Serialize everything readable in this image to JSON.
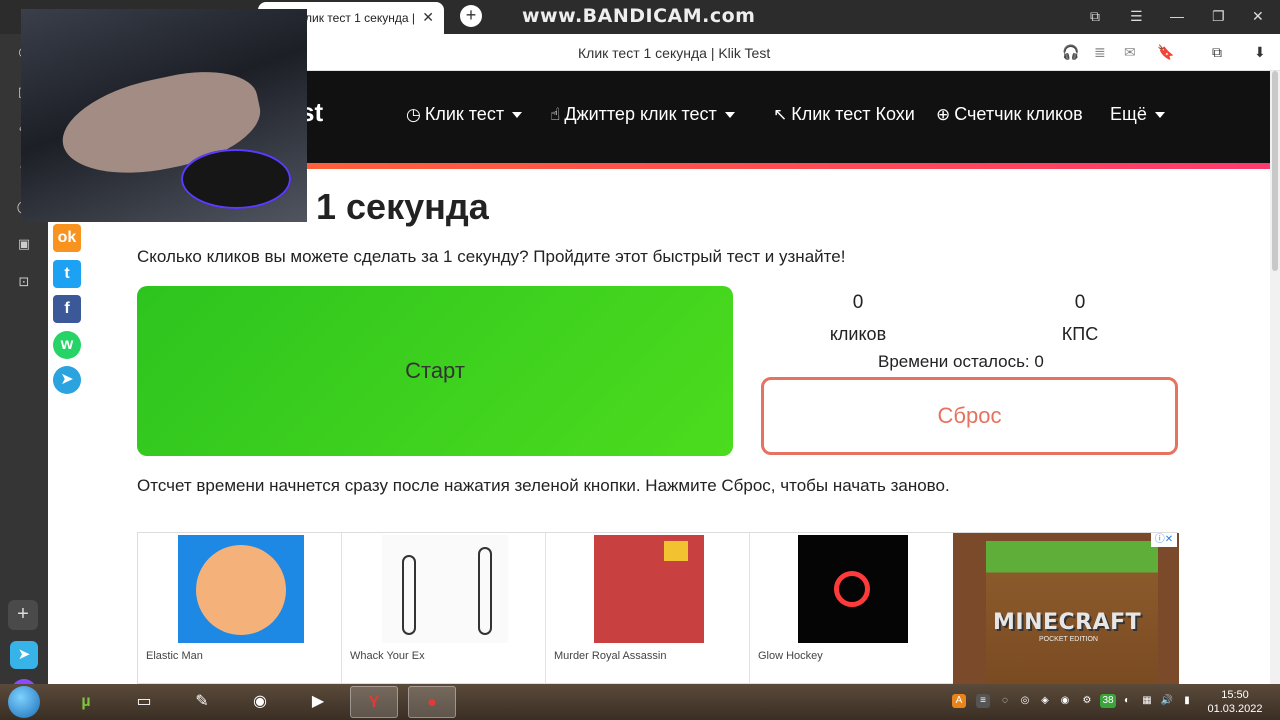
{
  "browser": {
    "tab_title": "Клик тест 1 секунда | Klik",
    "new_tab": "+",
    "watermark": "www.BANDICAM.com",
    "page_title": "Клик тест 1 секунда | Klik Test",
    "tab_close": "✕"
  },
  "site": {
    "logo_fragment": "st",
    "nav": [
      {
        "icon": "clock-icon",
        "label": "Клик тест"
      },
      {
        "icon": "jitter-icon",
        "label": "Джиттер клик тест"
      },
      {
        "icon": "cursor-icon",
        "label": "Клик тест Кохи"
      },
      {
        "icon": "plus-circle-icon",
        "label": "Счетчик кликов"
      },
      {
        "icon": "",
        "label": "Ещё"
      }
    ]
  },
  "main": {
    "heading": "1 секунда",
    "intro": "Сколько кликов вы можете сделать за 1 секунду? Пройдите этот быстрый тест и узнайте!",
    "start_label": "Старт",
    "clicks_value": "0",
    "clicks_label": "кликов",
    "cps_value": "0",
    "cps_label": "КПС",
    "timer_text": "Времени осталось: 0",
    "reset_label": "Сброс",
    "note": "Отсчет времени начнется сразу после нажатия зеленой кнопки. Нажмите Сброс, чтобы начать заново."
  },
  "share": [
    {
      "name": "odnoklassniki-icon",
      "glyph": "ok",
      "color": "#f7931e"
    },
    {
      "name": "twitter-icon",
      "glyph": "t",
      "color": "#1da1f2"
    },
    {
      "name": "facebook-icon",
      "glyph": "f",
      "color": "#3b5998"
    },
    {
      "name": "whatsapp-icon",
      "glyph": "w",
      "color": "#25d366"
    },
    {
      "name": "telegram-icon",
      "glyph": "➤",
      "color": "#2aa3df"
    }
  ],
  "games": [
    {
      "title": "Elastic Man"
    },
    {
      "title": "Whack Your Ex"
    },
    {
      "title": "Murder Royal Assassin"
    },
    {
      "title": "Glow Hockey"
    }
  ],
  "ad": {
    "title": "MINECRAFT",
    "subtitle": "POCKET EDITION",
    "close": "ⓘ✕"
  },
  "taskbar": {
    "time": "15:50",
    "date": "01.03.2022",
    "tray_badge": "38"
  }
}
